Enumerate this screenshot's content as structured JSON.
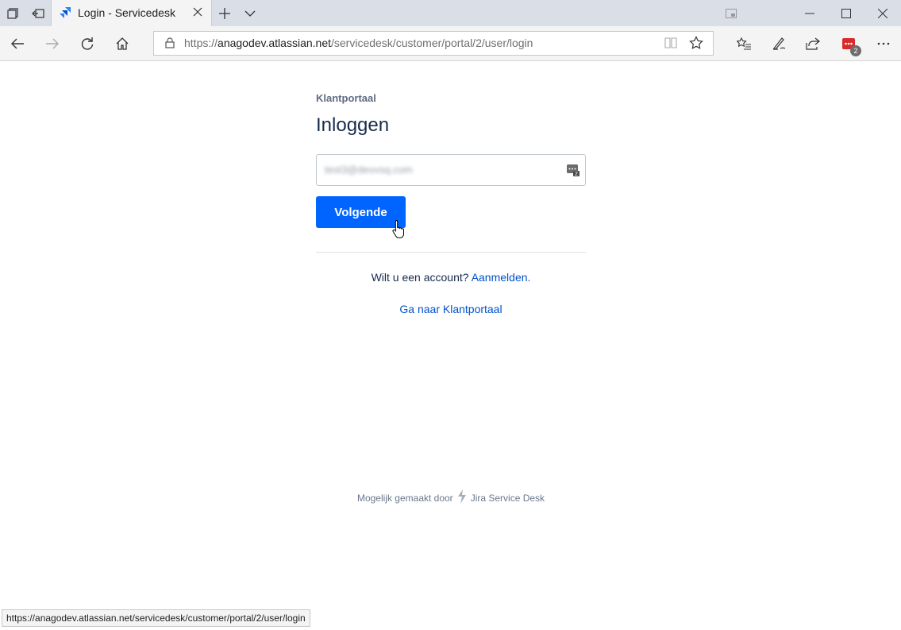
{
  "browser": {
    "tab_title": "Login - Servicedesk",
    "url_scheme": "https://",
    "url_host": "anagodev.atlassian.net",
    "url_path": "/servicedesk/customer/portal/2/user/login",
    "extension_badge_count": "2",
    "status_url": "https://anagodev.atlassian.net/servicedesk/customer/portal/2/user/login"
  },
  "page": {
    "portal_name": "Klantportaal",
    "title": "Inloggen",
    "email_value": "test3@devvsq.com",
    "next_button": "Volgende",
    "signup_prompt": "Wilt u een account?",
    "signup_link": "Aanmelden.",
    "goto_portal_link": "Ga naar Klantportaal",
    "footer_prefix": "Mogelijk gemaakt door",
    "footer_brand": "Jira Service Desk",
    "password_manager_badge": "2"
  },
  "colors": {
    "primary": "#0065ff",
    "link": "#0052cc",
    "heading": "#172b4d"
  }
}
